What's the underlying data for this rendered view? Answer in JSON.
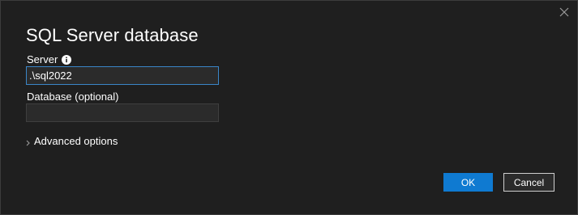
{
  "dialog": {
    "title": "SQL Server database",
    "close_icon": "close-icon"
  },
  "server": {
    "label": "Server",
    "info_icon": "info-icon",
    "value": ".\\sql2022"
  },
  "database": {
    "label": "Database (optional)",
    "value": ""
  },
  "advanced": {
    "label": "Advanced options",
    "icon": "chevron-right-icon"
  },
  "buttons": {
    "ok": "OK",
    "cancel": "Cancel"
  },
  "colors": {
    "background": "#1f1f1f",
    "accent": "#0f7ad1",
    "focus_border": "#3a86c8"
  }
}
